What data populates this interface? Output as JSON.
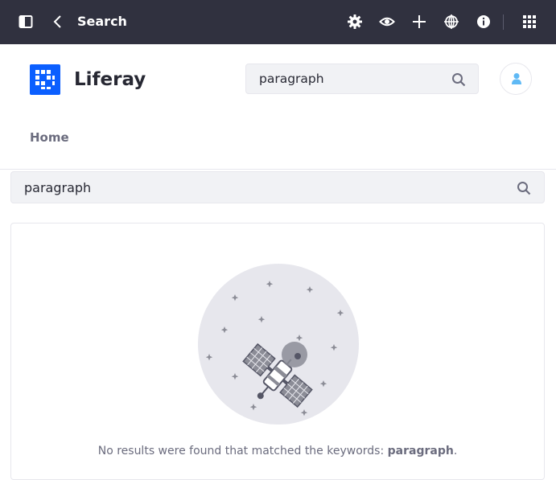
{
  "control_menu": {
    "title": "Search",
    "icons": [
      "sidebar-toggle-icon",
      "back-chevron-icon",
      "gear-icon",
      "eye-icon",
      "plus-icon",
      "globe-target-icon",
      "info-icon",
      "apps-grid-icon"
    ]
  },
  "site": {
    "name": "Liferay",
    "nav": [
      "Home"
    ]
  },
  "header_search": {
    "value": "paragraph"
  },
  "search_bar": {
    "value": "paragraph"
  },
  "results": {
    "message": "No results were found that matched the keywords: ",
    "keyword": "paragraph",
    "punctuation": "."
  },
  "colors": {
    "topbar": "#30313f",
    "brand": "#0b5fff",
    "avatar": "#5fb9f5",
    "text_secondary": "#6b6c7e"
  }
}
